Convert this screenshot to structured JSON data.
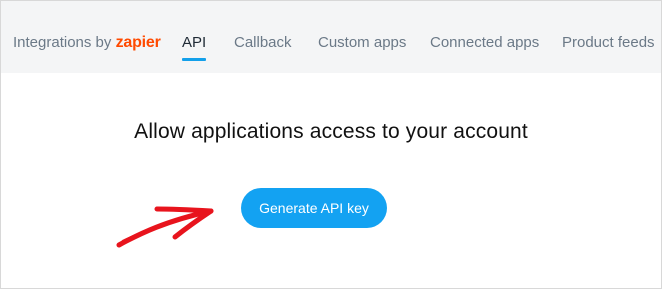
{
  "tabs": {
    "integrations_prefix": "Integrations by",
    "integrations_brand": "zapier",
    "api": "API",
    "callback": "Callback",
    "custom_apps": "Custom apps",
    "connected_apps": "Connected apps",
    "product_feeds": "Product feeds",
    "active": "API"
  },
  "main": {
    "heading": "Allow applications access to your account",
    "generate_button": "Generate API key"
  },
  "colors": {
    "accent": "#13a2f2",
    "zapier_brand": "#ff4a00",
    "annotation_arrow": "#e8141d",
    "tabbar_background": "#f4f5f6"
  },
  "icons": {
    "annotation": "red-hand-drawn-arrow-icon"
  }
}
